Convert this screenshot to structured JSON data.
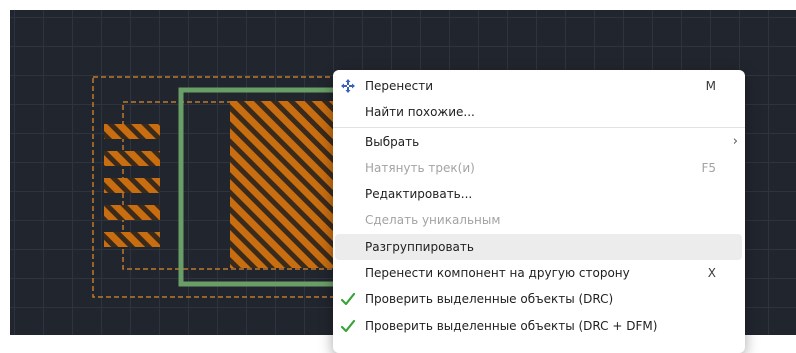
{
  "menu": {
    "items": [
      {
        "label": "Перенести",
        "shortcut": "M",
        "icon": "move-icon"
      },
      {
        "label": "Найти похожие..."
      },
      {
        "label": "Выбрать",
        "submenu": true
      },
      {
        "label": "Натянуть трек(и)",
        "shortcut": "F5",
        "disabled": true
      },
      {
        "label": "Редактировать..."
      },
      {
        "label": "Сделать уникальным",
        "disabled": true
      },
      {
        "label": "Разгруппировать",
        "hovered": true
      },
      {
        "label": "Перенести компонент на другую сторону",
        "shortcut": "X"
      },
      {
        "label": "Проверить выделенные объекты (DRC)",
        "icon": "checkmark-icon"
      },
      {
        "label": "Проверить выделенные объекты (DRC + DFM)",
        "icon": "checkmark-icon"
      }
    ],
    "submenu_arrow": "›"
  },
  "colors": {
    "canvas_bg": "#21252d",
    "pad_orange": "#c86d10",
    "outline_dash": "#c07a2e",
    "copper_green": "#6a9e67",
    "check_green": "#3aa23a",
    "move_icon_blue": "#3a5fb8"
  }
}
